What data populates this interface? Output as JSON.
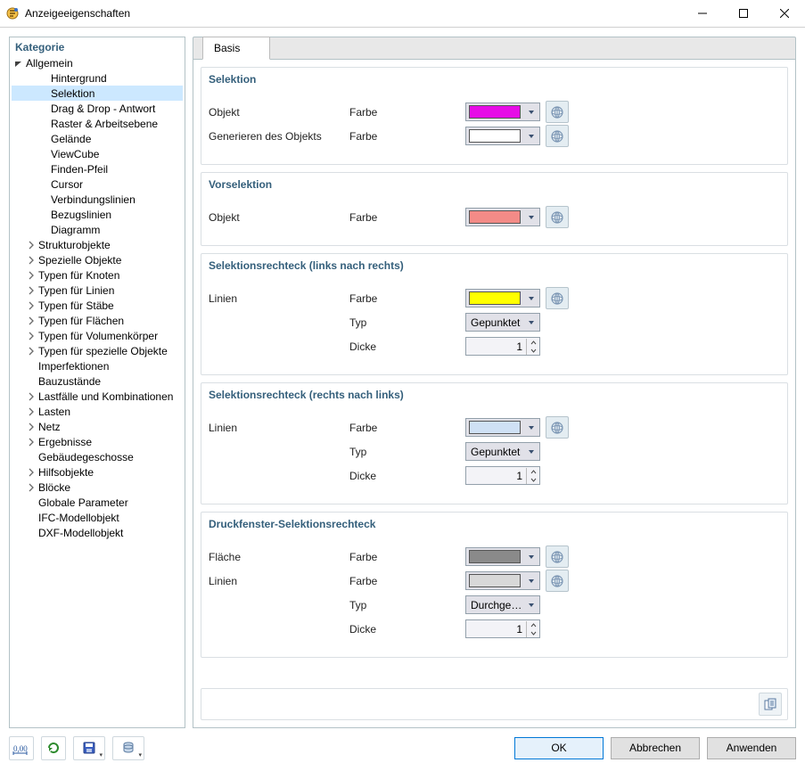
{
  "window": {
    "title": "Anzeigeeigenschaften"
  },
  "sidebar": {
    "title": "Kategorie"
  },
  "tree": {
    "root": "Allgemein",
    "children": [
      "Hintergrund",
      "Selektion",
      "Drag & Drop - Antwort",
      "Raster & Arbeitsebene",
      "Gelände",
      "ViewCube",
      "Finden-Pfeil",
      "Cursor",
      "Verbindungslinien",
      "Bezugslinien",
      "Diagramm"
    ],
    "selected": "Selektion",
    "top": [
      {
        "label": "Strukturobjekte",
        "expandable": true
      },
      {
        "label": "Spezielle Objekte",
        "expandable": true
      },
      {
        "label": "Typen für Knoten",
        "expandable": true
      },
      {
        "label": "Typen für Linien",
        "expandable": true
      },
      {
        "label": "Typen für Stäbe",
        "expandable": true
      },
      {
        "label": "Typen für Flächen",
        "expandable": true
      },
      {
        "label": "Typen für Volumenkörper",
        "expandable": true
      },
      {
        "label": "Typen für spezielle Objekte",
        "expandable": true
      },
      {
        "label": "Imperfektionen",
        "expandable": false
      },
      {
        "label": "Bauzustände",
        "expandable": false
      },
      {
        "label": "Lastfälle und Kombinationen",
        "expandable": true
      },
      {
        "label": "Lasten",
        "expandable": true
      },
      {
        "label": "Netz",
        "expandable": true
      },
      {
        "label": "Ergebnisse",
        "expandable": true
      },
      {
        "label": "Gebäudegeschosse",
        "expandable": false
      },
      {
        "label": "Hilfsobjekte",
        "expandable": true
      },
      {
        "label": "Blöcke",
        "expandable": true
      },
      {
        "label": "Globale Parameter",
        "expandable": false
      },
      {
        "label": "IFC-Modellobjekt",
        "expandable": false
      },
      {
        "label": "DXF-Modellobjekt",
        "expandable": false
      }
    ]
  },
  "tabs": {
    "basis": "Basis"
  },
  "labels": {
    "farbe": "Farbe",
    "typ": "Typ",
    "dicke": "Dicke",
    "objekt": "Objekt",
    "gen_objekt": "Generieren des Objekts",
    "linien": "Linien",
    "flaeche": "Fläche"
  },
  "sections": {
    "s1": {
      "title": "Selektion",
      "rows": [
        {
          "name": "objekt",
          "prop": "farbe",
          "color": "#e60ce6"
        },
        {
          "name": "gen_objekt",
          "prop": "farbe",
          "color": "#ffffff"
        }
      ]
    },
    "s2": {
      "title": "Vorselektion",
      "rows": [
        {
          "name": "objekt",
          "prop": "farbe",
          "color": "#f38b87"
        }
      ]
    },
    "s3": {
      "title": "Selektionsrechteck (links nach rechts)",
      "rows": [
        {
          "name": "linien",
          "prop": "farbe",
          "color": "#ffff00"
        },
        {
          "name": "linien",
          "prop": "typ",
          "select": "Gepunktet"
        },
        {
          "name": "linien",
          "prop": "dicke",
          "spinner": 1
        }
      ]
    },
    "s4": {
      "title": "Selektionsrechteck (rechts nach links)",
      "rows": [
        {
          "name": "linien",
          "prop": "farbe",
          "color": "#cfe1f5"
        },
        {
          "name": "linien",
          "prop": "typ",
          "select": "Gepunktet"
        },
        {
          "name": "linien",
          "prop": "dicke",
          "spinner": 1
        }
      ]
    },
    "s5": {
      "title": "Druckfenster-Selektionsrechteck",
      "rows": [
        {
          "name": "flaeche",
          "prop": "farbe",
          "color": "#8a8a8a"
        },
        {
          "name": "linien",
          "prop": "farbe",
          "color": "#d8d8d8"
        },
        {
          "name": "linien",
          "prop": "typ",
          "select": "Durchgezo..."
        },
        {
          "name": "linien",
          "prop": "dicke",
          "spinner": 1
        }
      ]
    }
  },
  "buttons": {
    "ok": "OK",
    "cancel": "Abbrechen",
    "apply": "Anwenden"
  }
}
